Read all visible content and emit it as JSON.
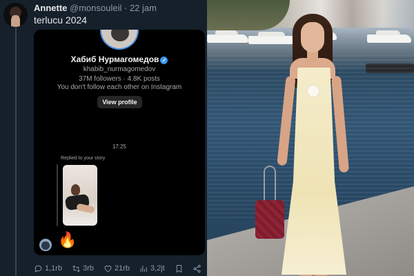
{
  "tweet": {
    "author_name": "Annette",
    "author_handle": "@monsouleil",
    "separator": "·",
    "time": "22 jam",
    "text": "terlucu 2024"
  },
  "dm": {
    "profile_name": "Хабиб Нурмагомедов",
    "username": "khabib_nurmagomedov",
    "stats": "37M followers · 4.8K posts",
    "follow_status": "You don't follow each other on Instagram",
    "view_profile_label": "View profile",
    "timestamp": "17:25",
    "replied_label": "Replied to your story",
    "reaction": "🔥"
  },
  "actions": {
    "replies": "1,1rb",
    "retweets": "3rb",
    "likes": "21rb",
    "views": "3,2jt"
  },
  "colors": {
    "background": "#15202b",
    "card": "#000000",
    "muted": "#8b98a5",
    "verified": "#3897f0"
  },
  "icons": [
    "reply-icon",
    "retweet-icon",
    "like-icon",
    "views-icon",
    "bookmark-icon",
    "share-icon",
    "verified-icon",
    "fire-emoji"
  ]
}
